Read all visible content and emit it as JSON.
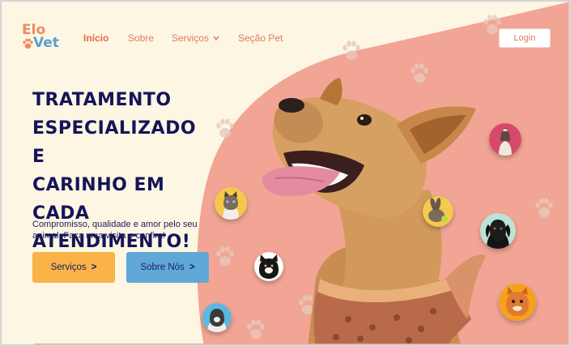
{
  "brand": {
    "line1": "Elo",
    "line2": "Vet"
  },
  "nav": {
    "items": [
      {
        "label": "Início"
      },
      {
        "label": "Sobre"
      },
      {
        "label": "Serviços"
      },
      {
        "label": "Seção Pet"
      }
    ],
    "login_label": "Login"
  },
  "hero": {
    "headline_lines": [
      "TRATAMENTO",
      "ESPECIALIZADO E",
      "CARINHO EM CADA",
      "ATENDIMENTO!"
    ],
    "subtitle": "Compromisso, qualidade e amor pelo seu animal. Faça uma visita e confira!",
    "buttons": [
      {
        "label": "Serviços",
        "arrow": ">"
      },
      {
        "label": "Sobre Nós",
        "arrow": ">"
      }
    ]
  },
  "colors": {
    "background": "#fdf6e3",
    "blob": "#f2a595",
    "accent_orange": "#e07a5f",
    "navy": "#14145a",
    "button_yellow": "#f9b348",
    "button_blue": "#5fa8d8"
  },
  "icons": [
    "paw-icon",
    "chevron-down-icon",
    "chevron-right-icon"
  ]
}
